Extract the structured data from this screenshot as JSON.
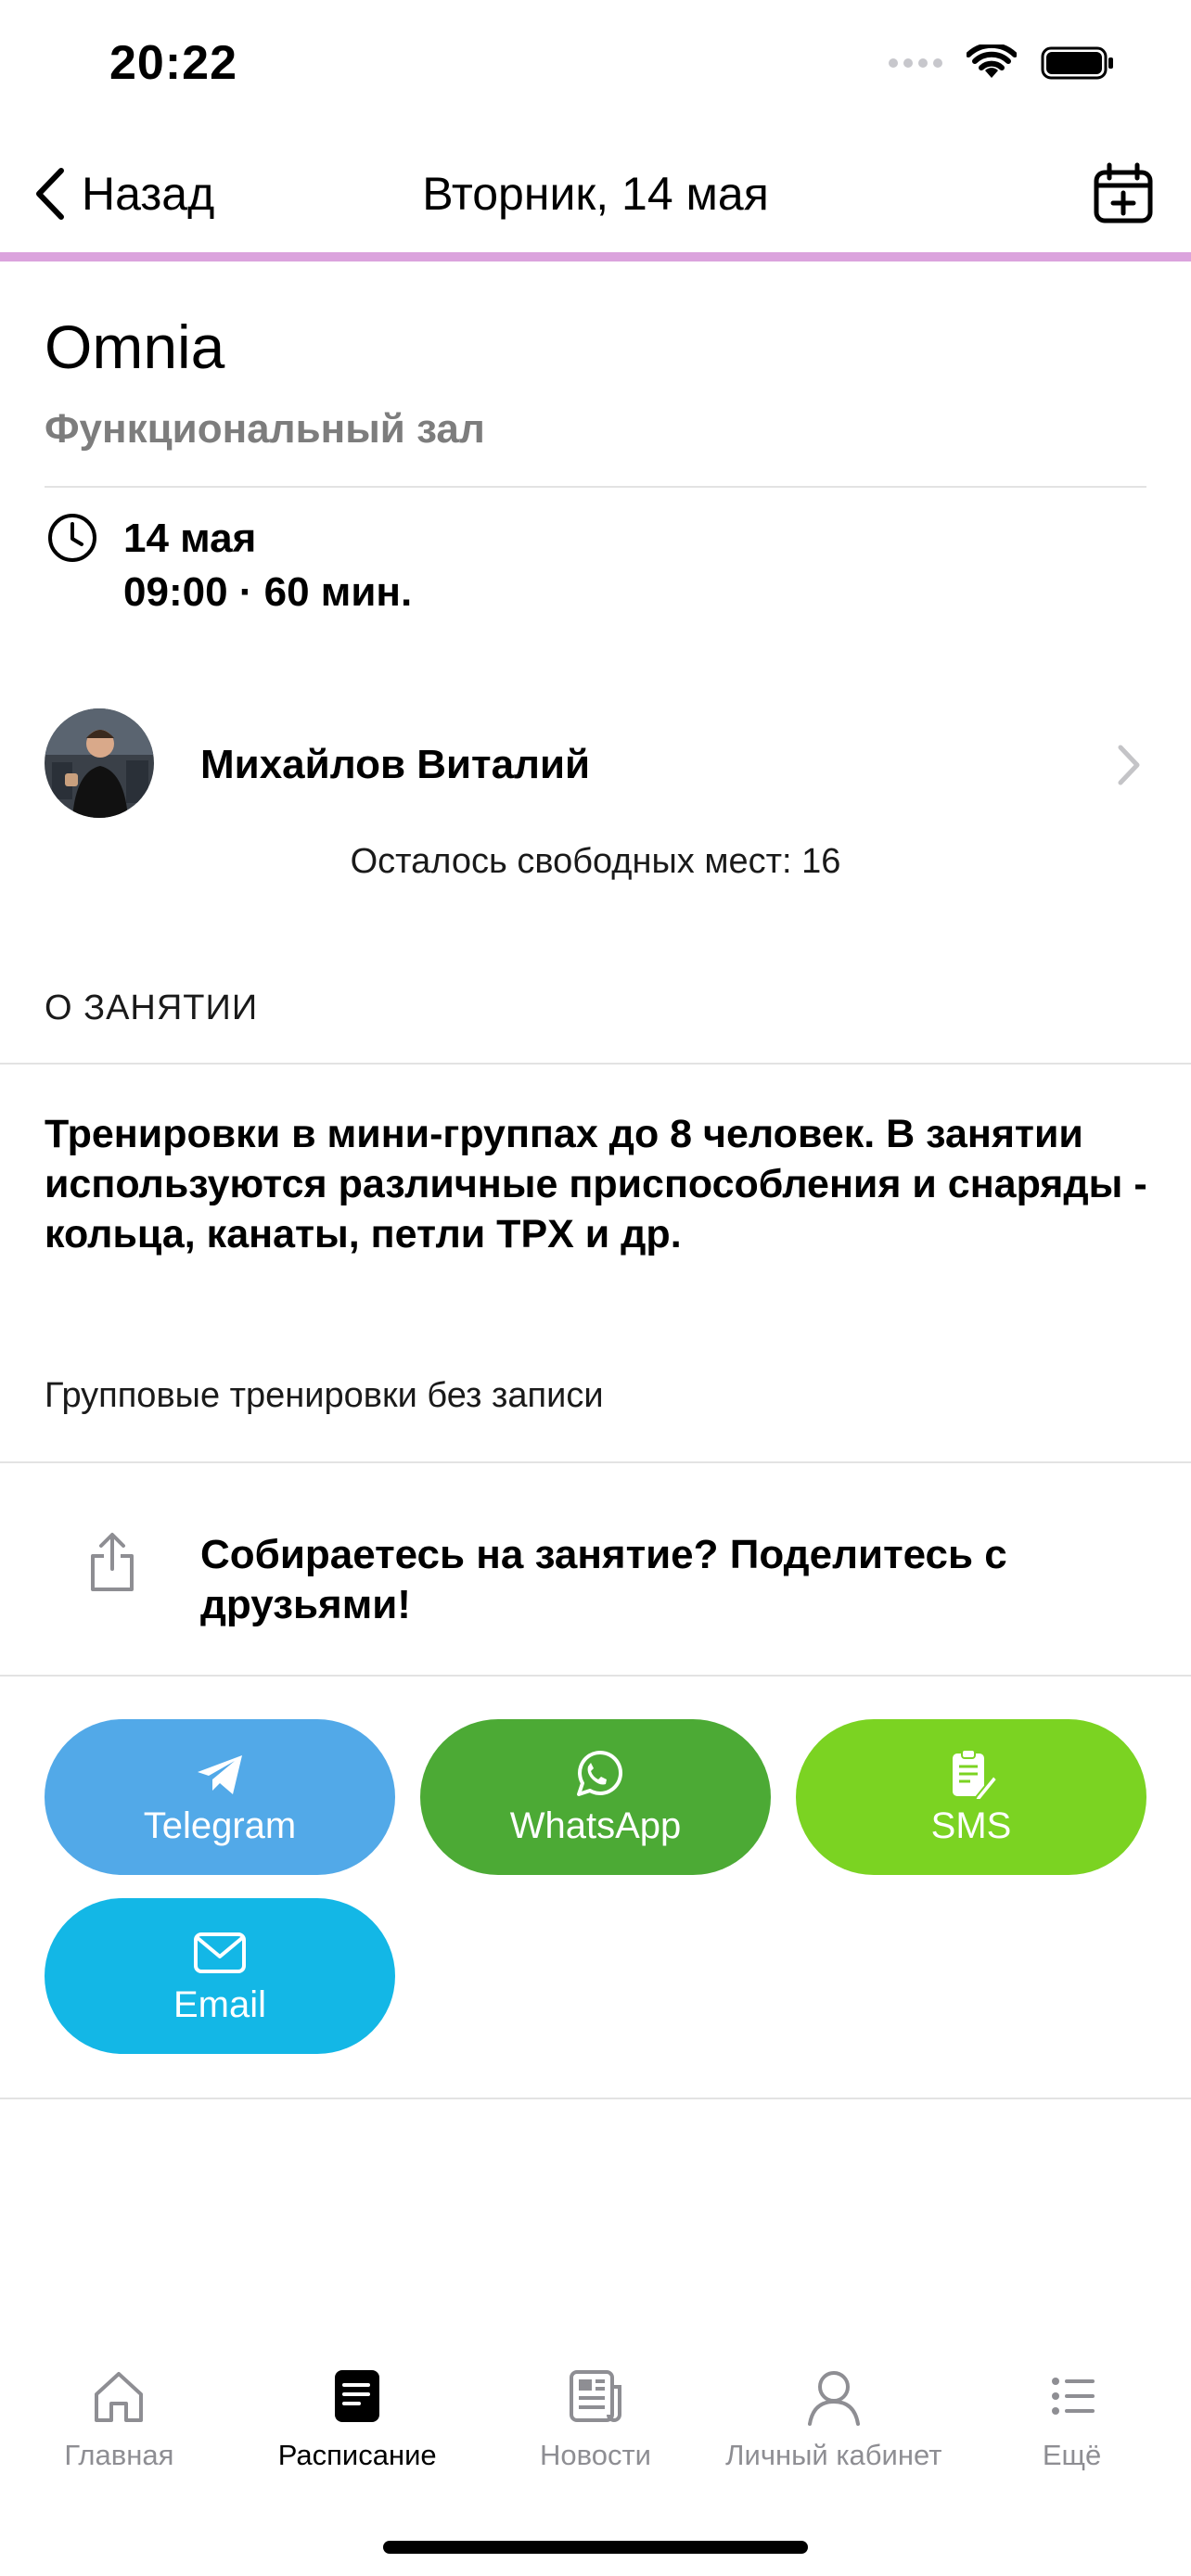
{
  "status_bar": {
    "time": "20:22"
  },
  "nav": {
    "back_label": "Назад",
    "title": "Вторник, 14 мая",
    "accent_color": "#dba3dd"
  },
  "class": {
    "title": "Omnia",
    "room": "Функциональный зал",
    "date": "14 мая",
    "time": "09:00 · 60 мин."
  },
  "trainer": {
    "name": "Михайлов Виталий",
    "free_spots": "Осталось свободных мест: 16"
  },
  "about": {
    "section_title": "О ЗАНЯТИИ",
    "description": "Тренировки в мини-группах до 8 человек. В занятии используются различные приспособления и снаряды - кольца, канаты, петли TPX и др.",
    "note": "Групповые тренировки без записи"
  },
  "share": {
    "prompt": "Собираетесь на занятие? Поделитесь с друзьями!",
    "buttons": [
      {
        "label": "Telegram",
        "icon": "telegram-icon",
        "color": "#52a9e8"
      },
      {
        "label": "WhatsApp",
        "icon": "whatsapp-icon",
        "color": "#4caa35"
      },
      {
        "label": "SMS",
        "icon": "sms-icon",
        "color": "#7bd322"
      },
      {
        "label": "Email",
        "icon": "email-icon",
        "color": "#13b7e6"
      }
    ]
  },
  "tabs": [
    {
      "label": "Главная",
      "icon": "home-icon",
      "active": false
    },
    {
      "label": "Расписание",
      "icon": "schedule-icon",
      "active": true
    },
    {
      "label": "Новости",
      "icon": "news-icon",
      "active": false
    },
    {
      "label": "Личный кабинет",
      "icon": "profile-icon",
      "active": false
    },
    {
      "label": "Ещё",
      "icon": "more-icon",
      "active": false
    }
  ]
}
